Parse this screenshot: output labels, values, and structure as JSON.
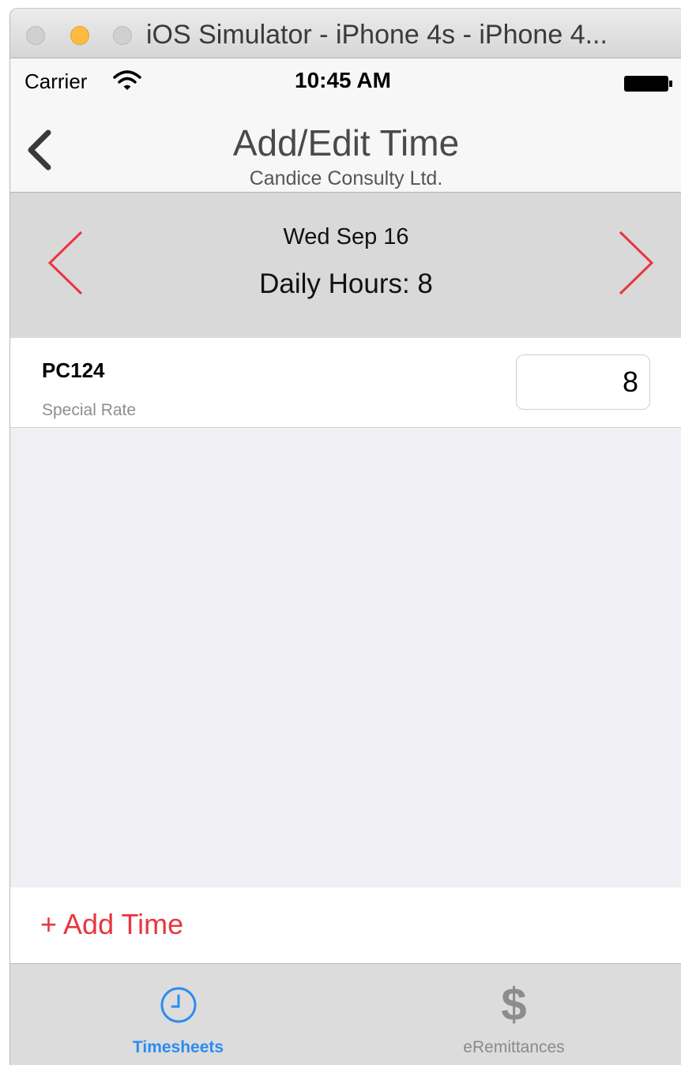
{
  "window": {
    "title": "iOS Simulator - iPhone 4s - iPhone 4..."
  },
  "status_bar": {
    "carrier": "Carrier",
    "time": "10:45 AM"
  },
  "nav": {
    "title": "Add/Edit Time",
    "subtitle": "Candice Consulty Ltd."
  },
  "day": {
    "date": "Wed Sep 16",
    "daily_hours": "Daily Hours: 8"
  },
  "entries": [
    {
      "code": "PC124",
      "rate": "Special Rate",
      "hours": "8"
    }
  ],
  "add_time": {
    "label": "+ Add Time"
  },
  "tabs": [
    {
      "label": "Timesheets",
      "icon": "clock-icon",
      "selected": true
    },
    {
      "label": "eRemittances",
      "icon": "dollar-icon",
      "selected": false
    }
  ],
  "colors": {
    "accent_red": "#e8363e",
    "tab_selected_blue": "#2b8cf2"
  }
}
